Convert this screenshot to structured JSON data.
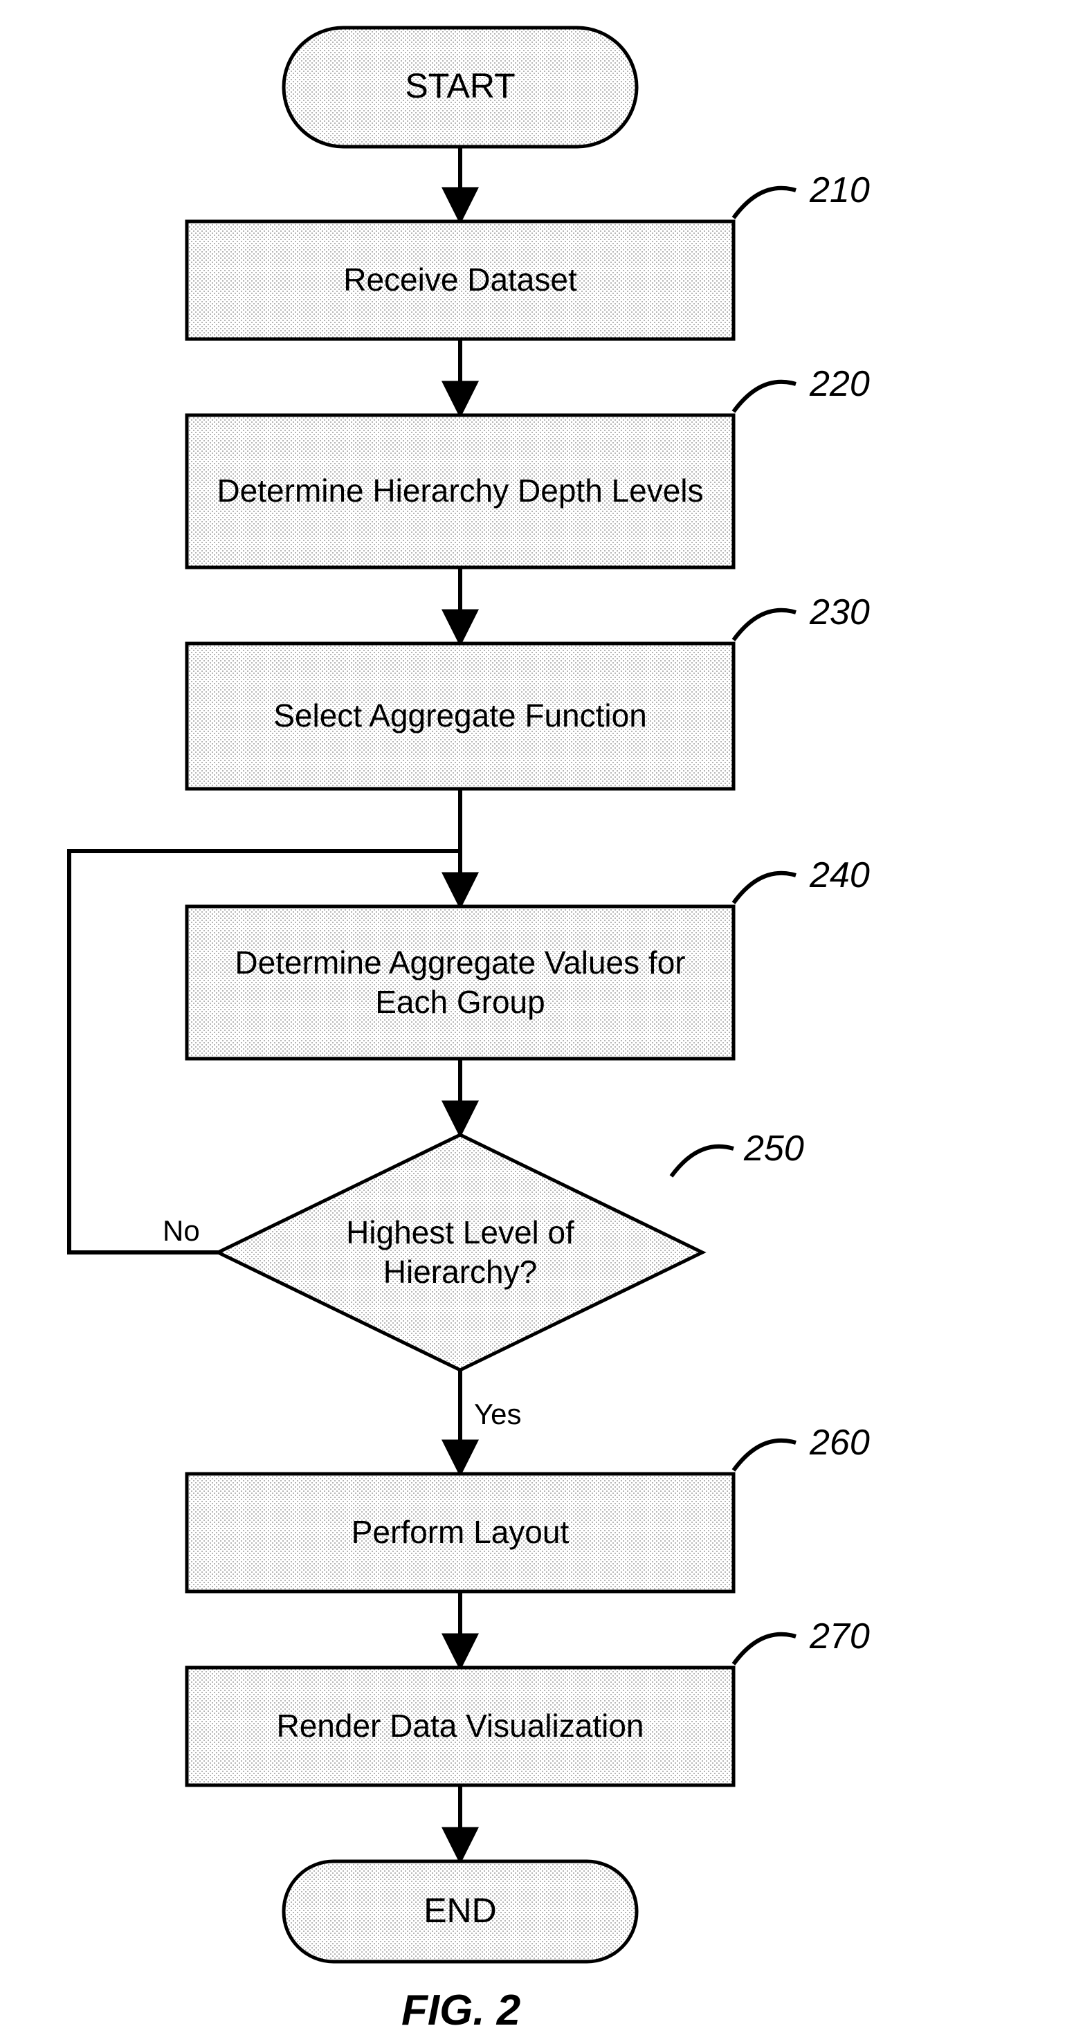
{
  "terminals": {
    "start": "START",
    "end": "END"
  },
  "steps": {
    "s210": {
      "ref": "210",
      "label": "Receive Dataset"
    },
    "s220": {
      "ref": "220",
      "label": "Determine Hierarchy Depth Levels"
    },
    "s230": {
      "ref": "230",
      "label": "Select Aggregate Function"
    },
    "s240": {
      "ref": "240",
      "label": "Determine Aggregate Values for Each Group"
    },
    "s250": {
      "ref": "250",
      "label": "Highest Level of Hierarchy?"
    },
    "s260": {
      "ref": "260",
      "label": "Perform Layout"
    },
    "s270": {
      "ref": "270",
      "label": "Render Data Visualization"
    }
  },
  "edges": {
    "no": "No",
    "yes": "Yes"
  },
  "figure": "FIG. 2"
}
